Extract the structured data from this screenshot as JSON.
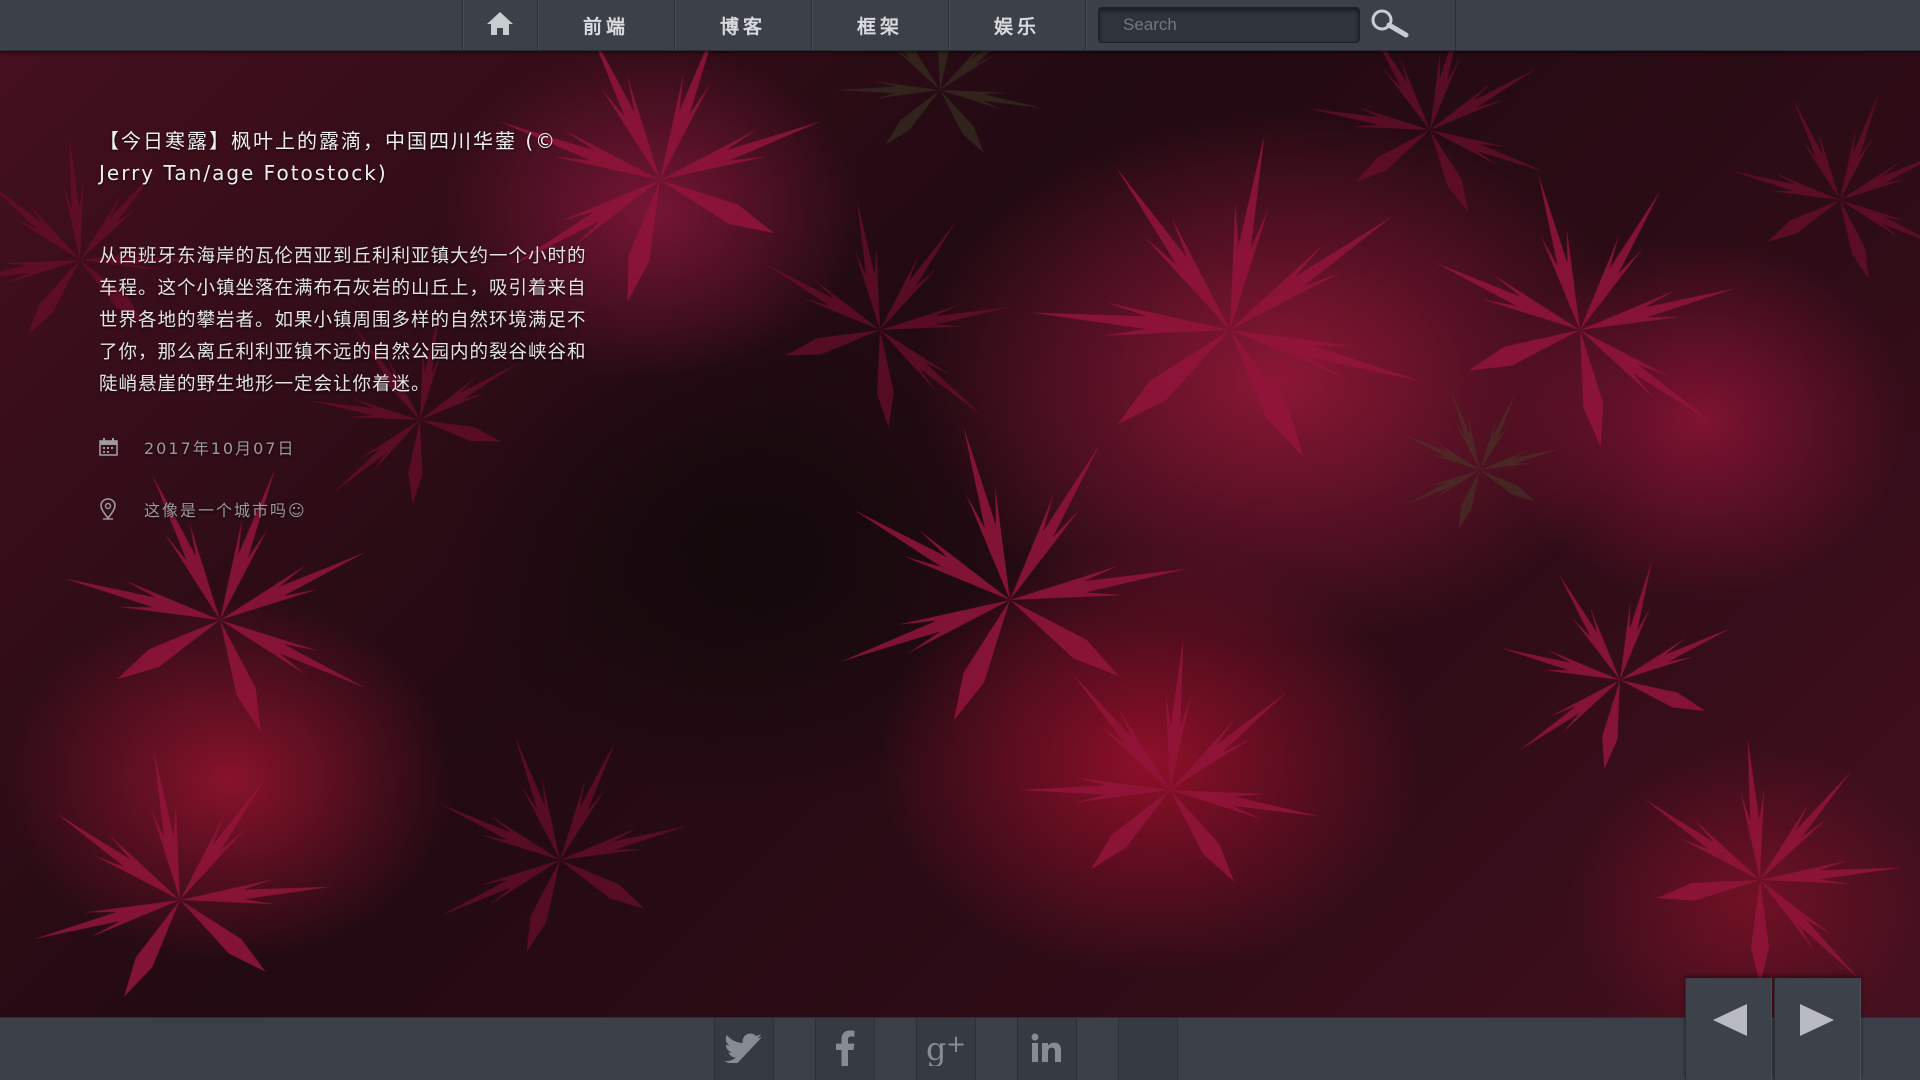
{
  "nav": {
    "home_icon": "home-icon",
    "items": [
      {
        "label": "前端"
      },
      {
        "label": "博客"
      },
      {
        "label": "框架"
      },
      {
        "label": "娱乐"
      }
    ],
    "search_placeholder": "Search",
    "search_icon": "magnifier-icon"
  },
  "article": {
    "title": "【今日寒露】枫叶上的露滴，中国四川华蓥 (© Jerry Tan/age Fotostock)",
    "description": "从西班牙东海岸的瓦伦西亚到丘利利亚镇大约一个小时的车程。这个小镇坐落在满布石灰岩的山丘上，吸引着来自世界各地的攀岩者。如果小镇周围多样的自然环境满足不了你，那么离丘利利亚镇不远的自然公园内的裂谷峡谷和陡峭悬崖的野生地形一定会让你着迷。",
    "date": "2017年10月07日",
    "date_icon": "calendar-icon",
    "location": "这像是一个城市吗☺",
    "location_icon": "location-pin-icon"
  },
  "footer": {
    "social": [
      {
        "icon": "twitter-icon"
      },
      {
        "icon": "facebook-icon"
      },
      {
        "icon": "google-plus-icon"
      },
      {
        "icon": "linkedin-icon"
      },
      {
        "icon": "empty-slot"
      }
    ],
    "prev_icon": "arrow-left-icon",
    "next_icon": "arrow-right-icon"
  },
  "colors": {
    "bar": "#3c4049",
    "bar_border": "#2a2d33",
    "nav_text": "#d8dade",
    "icon": "#c9ccd1",
    "background_accent": "#c4184a"
  }
}
